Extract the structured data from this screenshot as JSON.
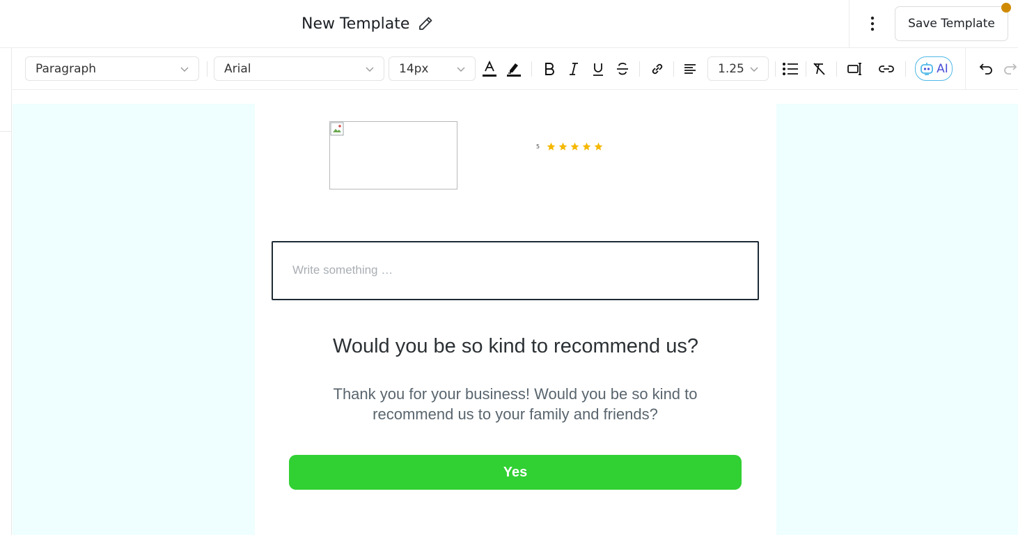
{
  "header": {
    "title": "New Template",
    "save_label": "Save Template"
  },
  "toolbar": {
    "block_type": "Paragraph",
    "font_family": "Arial",
    "font_size": "14px",
    "line_height": "1.25",
    "ai_label": "AI",
    "icons": [
      "text-color-icon",
      "highlight-icon",
      "bold-icon",
      "italic-icon",
      "underline-icon",
      "strikethrough-icon",
      "link-icon",
      "align-left-icon",
      "bullet-list-icon",
      "clear-format-icon",
      "insert-field-icon",
      "insert-link-icon",
      "ai-assistant-icon",
      "undo-icon",
      "redo-icon"
    ]
  },
  "email": {
    "rating_value": "5",
    "rating_stars": 5,
    "textbox_placeholder": "Write something …",
    "headline": "Would you be so kind to recommend us?",
    "body": "Thank you for your business! Would you be so kind to recommend us to your family and friends?",
    "button_label": "Yes"
  },
  "colors": {
    "canvas_bg": "#effefe",
    "button_green": "#31d033",
    "star_gold": "#f5b800",
    "notification_dot": "#d08a00",
    "ai_border": "#4fb8e8"
  }
}
